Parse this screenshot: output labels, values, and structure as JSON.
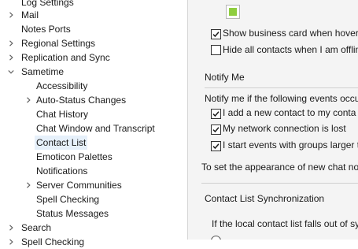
{
  "tree": {
    "items": [
      {
        "label": "Log Settings",
        "chevron": "none"
      },
      {
        "label": "Mail",
        "chevron": "right"
      },
      {
        "label": "Notes Ports",
        "chevron": "none"
      },
      {
        "label": "Regional Settings",
        "chevron": "right"
      },
      {
        "label": "Replication and Sync",
        "chevron": "right"
      },
      {
        "label": "Sametime",
        "chevron": "down"
      },
      {
        "label": "Accessibility",
        "chevron": "none"
      },
      {
        "label": "Auto-Status Changes",
        "chevron": "right"
      },
      {
        "label": "Chat History",
        "chevron": "none"
      },
      {
        "label": "Chat Window and Transcript",
        "chevron": "none"
      },
      {
        "label": "Contact List",
        "chevron": "none",
        "selected": true
      },
      {
        "label": "Emoticon Palettes",
        "chevron": "none"
      },
      {
        "label": "Notifications",
        "chevron": "none"
      },
      {
        "label": "Server Communities",
        "chevron": "right"
      },
      {
        "label": "Spell Checking",
        "chevron": "none"
      },
      {
        "label": "Status Messages",
        "chevron": "none"
      },
      {
        "label": "Search",
        "chevron": "right"
      },
      {
        "label": "Spell Checking",
        "chevron": "right"
      }
    ]
  },
  "panel": {
    "swatch_color": "#8fce3f",
    "show_business_card": {
      "label": "Show business card when hoverin",
      "checked": true
    },
    "hide_all_contacts": {
      "label": "Hide all contacts when I am offlin",
      "checked": false
    },
    "notify_title": "Notify Me",
    "notify_intro": "Notify me if the following events occu",
    "notify_options": [
      {
        "label": "I add a new contact to my conta",
        "checked": true
      },
      {
        "label": "My network connection is lost",
        "checked": true
      },
      {
        "label": "I start events with groups larger t",
        "checked": true
      }
    ],
    "appearance_text": "To set the appearance of new chat not",
    "sync_title": "Contact List Synchronization",
    "sync_text": "If the local contact list falls out of sy"
  }
}
